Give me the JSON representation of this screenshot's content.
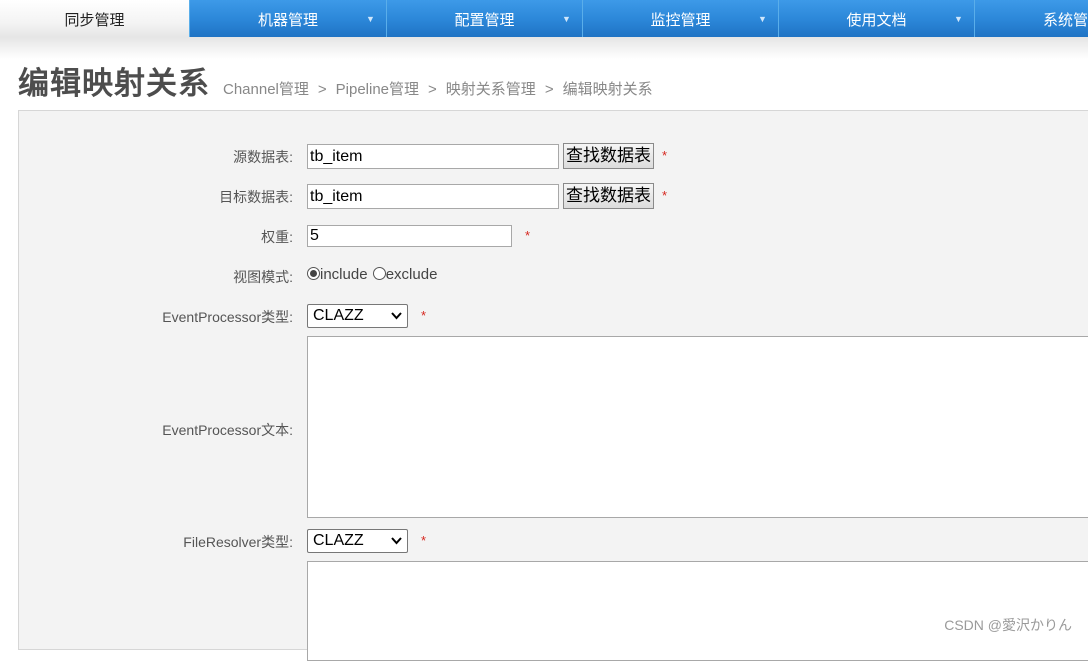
{
  "nav": {
    "items": [
      {
        "label": "同步管理",
        "active": true
      },
      {
        "label": "机器管理"
      },
      {
        "label": "配置管理"
      },
      {
        "label": "监控管理"
      },
      {
        "label": "使用文档"
      },
      {
        "label": "系统管"
      }
    ],
    "caret": "▼"
  },
  "page": {
    "title": "编辑映射关系",
    "breadcrumb": [
      "Channel管理",
      "Pipeline管理",
      "映射关系管理",
      "编辑映射关系"
    ],
    "separator": ">"
  },
  "form": {
    "source_table": {
      "label": "源数据表:",
      "value": "tb_item",
      "button": "查找数据表",
      "required": "*"
    },
    "target_table": {
      "label": "目标数据表:",
      "value": "tb_item",
      "button": "查找数据表",
      "required": "*"
    },
    "weight": {
      "label": "权重:",
      "value": "5",
      "required": "*"
    },
    "view_mode": {
      "label": "视图模式:",
      "options": [
        "include",
        "exclude"
      ],
      "selected": "include"
    },
    "event_processor_type": {
      "label": "EventProcessor类型:",
      "value": "CLAZZ",
      "required": "*"
    },
    "event_processor_text": {
      "label": "EventProcessor文本:",
      "value": ""
    },
    "file_resolver_type": {
      "label": "FileResolver类型:",
      "value": "CLAZZ",
      "required": "*"
    },
    "file_resolver_text": {
      "value": ""
    }
  },
  "watermark": "CSDN @愛沢かりん",
  "colors": {
    "nav_blue": "#2b86d8",
    "required": "#d6261e",
    "panel_bg": "#f3f3f3"
  },
  "icons": {
    "select_arrow": "chevron-down-icon",
    "nav_caret": "caret-down-icon"
  }
}
